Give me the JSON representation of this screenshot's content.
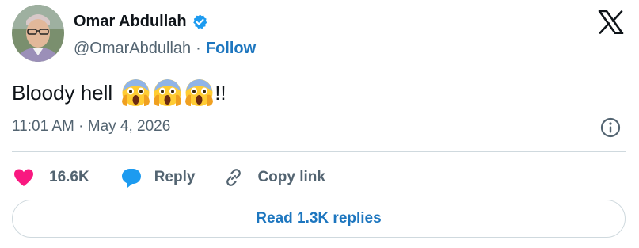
{
  "author": {
    "name": "Omar Abdullah",
    "handle": "@OmarAbdullah",
    "separator": "·",
    "follow_label": "Follow",
    "verified_icon": "verified-badge-icon"
  },
  "tweet": {
    "text": "Bloody hell",
    "emoji_count": 3,
    "emoji_icon": "face-screaming-in-fear-icon",
    "suffix": "!!",
    "timestamp": "11:01 AM · May 4, 2026"
  },
  "actions": {
    "like_count": "16.6K",
    "reply_label": "Reply",
    "copy_label": "Copy link"
  },
  "read_replies_label": "Read 1.3K replies",
  "colors": {
    "link": "#1d76bf",
    "like": "#f91880",
    "reply": "#1d9bf0",
    "muted": "#536471",
    "border": "#cfd9de"
  }
}
